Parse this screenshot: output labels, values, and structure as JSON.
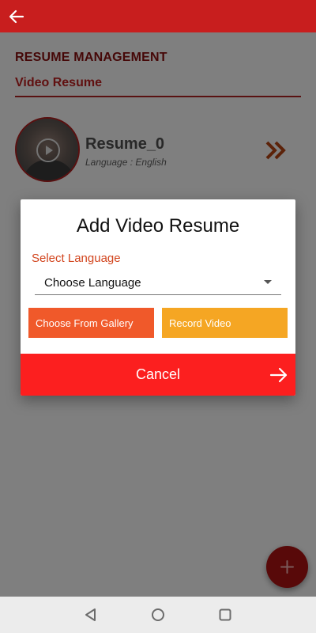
{
  "header": {
    "back_icon": "arrow-left-icon",
    "page_heading": "RESUME MANAGEMENT"
  },
  "section": {
    "title": "Video Resume"
  },
  "resume_item": {
    "name": "Resume_0",
    "language_text": "Language : English",
    "play_icon": "play-icon",
    "open_icon": "double-chevron-right-icon"
  },
  "dialog": {
    "title": "Add Video Resume",
    "language_label": "Select Language",
    "language_select_value": "Choose Language",
    "gallery_button": "Choose From Gallery",
    "record_button": "Record Video",
    "cancel_button": "Cancel"
  },
  "fab": {
    "icon": "plus-icon"
  },
  "system_nav": {
    "back": "triangle-back-icon",
    "home": "circle-home-icon",
    "recents": "square-recents-icon"
  },
  "colors": {
    "brand_red": "#c81e1e",
    "cancel_red": "#fc1f1f",
    "gallery_orange": "#f0592a",
    "record_amber": "#f5a623",
    "label_orange": "#d2451e",
    "chevron_color": "#b84412"
  }
}
